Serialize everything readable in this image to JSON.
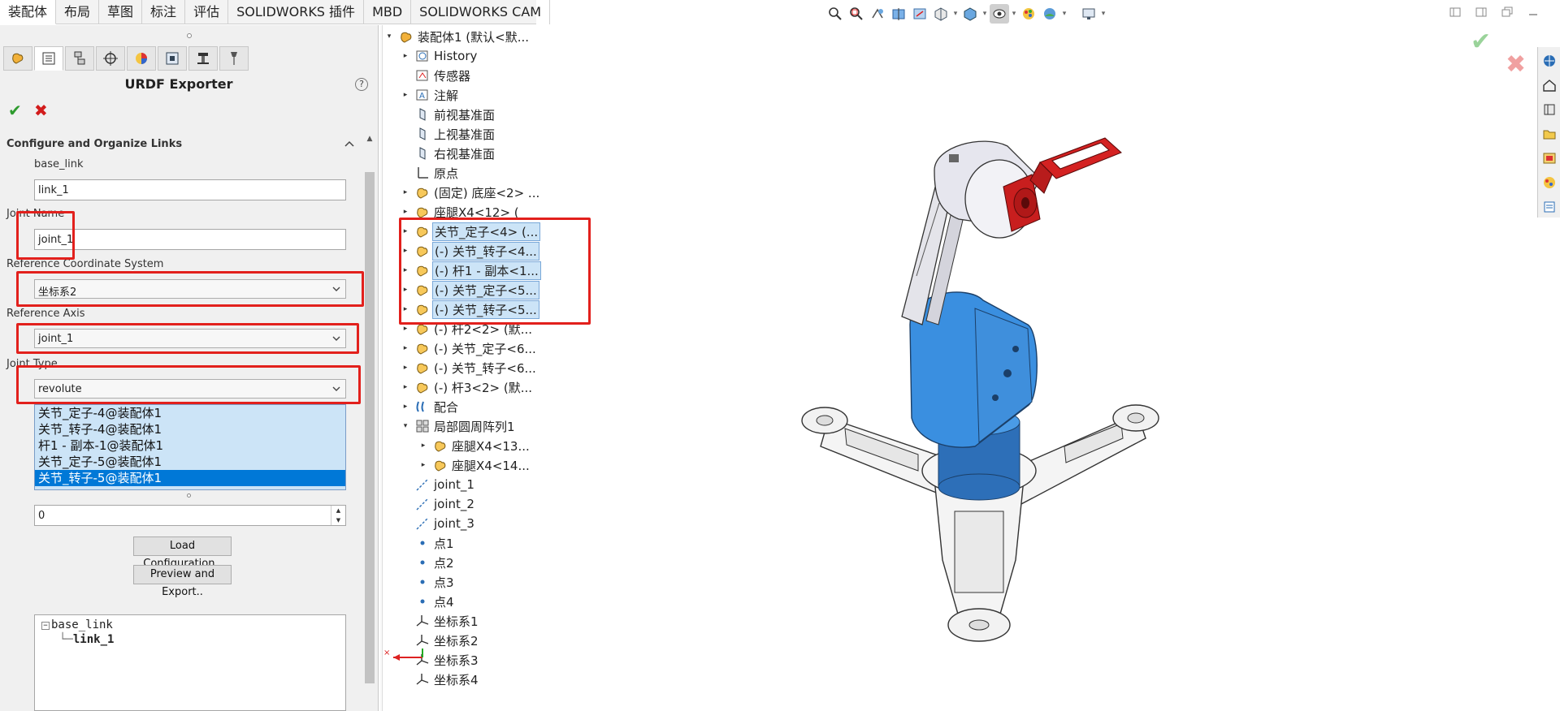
{
  "tabs": [
    "装配体",
    "布局",
    "草图",
    "标注",
    "评估",
    "SOLIDWORKS 插件",
    "MBD",
    "SOLIDWORKS CAM"
  ],
  "active_tab": "装配体",
  "hud_icons": [
    "zoom-to-fit-icon",
    "zoom-area-icon",
    "previous-view-icon",
    "section-view-icon",
    "dynamic-annotation-icon",
    "view-orientation-icon",
    "display-style-icon",
    "hide-show-icon",
    "edit-appearance-icon",
    "apply-scene-icon",
    "view-settings-icon"
  ],
  "property_manager": {
    "title": "URDF Exporter",
    "help": "?",
    "ok": "✔",
    "cancel": "✖",
    "group": "Configure and Organize Links",
    "link_label": "base_link",
    "link_name": "link_1",
    "joint_name_label": "Joint Name",
    "joint_name": "joint_1",
    "ref_coord_label": "Reference Coordinate System",
    "ref_coord": "坐标系2",
    "ref_axis_label": "Reference Axis",
    "ref_axis": "joint_1",
    "joint_type_label": "Joint Type",
    "joint_type": "revolute",
    "components": [
      "关节_定子-4@装配体1",
      "关节_转子-4@装配体1",
      "杆1 - 副本-1@装配体1",
      "关节_定子-5@装配体1",
      "关节_转子-5@装配体1"
    ],
    "selected_component_index": 4,
    "child_count": "0",
    "load_button": "Load Configuration..",
    "export_button": "Preview and Export..",
    "link_tree": {
      "root": "base_link",
      "child": "link_1"
    }
  },
  "feature_tree": [
    {
      "label": "装配体1 (默认<默...",
      "exp": "▾",
      "icon": "assembly-icon",
      "indent": 0
    },
    {
      "label": "History",
      "exp": "▸",
      "icon": "history-icon",
      "indent": 1
    },
    {
      "label": "传感器",
      "exp": "",
      "icon": "sensor-icon",
      "indent": 1
    },
    {
      "label": "注解",
      "exp": "▸",
      "icon": "annotation-icon",
      "indent": 1
    },
    {
      "label": "前视基准面",
      "exp": "",
      "icon": "plane-icon",
      "indent": 1
    },
    {
      "label": "上视基准面",
      "exp": "",
      "icon": "plane-icon",
      "indent": 1
    },
    {
      "label": "右视基准面",
      "exp": "",
      "icon": "plane-icon",
      "indent": 1
    },
    {
      "label": "原点",
      "exp": "",
      "icon": "origin-icon",
      "indent": 1
    },
    {
      "label": "(固定) 底座<2> ...",
      "exp": "▸",
      "icon": "part-icon",
      "indent": 1
    },
    {
      "label": "座腿X4<12> (",
      "exp": "▸",
      "icon": "part-icon",
      "indent": 1
    },
    {
      "label": "关节_定子<4> (...",
      "exp": "▸",
      "icon": "part-icon",
      "indent": 1,
      "hl": true
    },
    {
      "label": "(-) 关节_转子<4...",
      "exp": "▸",
      "icon": "part-icon",
      "indent": 1,
      "hl": true
    },
    {
      "label": "(-) 杆1 - 副本<1...",
      "exp": "▸",
      "icon": "part-icon",
      "indent": 1,
      "hl": true
    },
    {
      "label": "(-) 关节_定子<5...",
      "exp": "▸",
      "icon": "part-icon",
      "indent": 1,
      "hl": true
    },
    {
      "label": "(-) 关节_转子<5...",
      "exp": "▸",
      "icon": "part-icon",
      "indent": 1,
      "hl": true
    },
    {
      "label": "(-) 杆2<2> (默...",
      "exp": "▸",
      "icon": "part-icon",
      "indent": 1
    },
    {
      "label": "(-) 关节_定子<6...",
      "exp": "▸",
      "icon": "part-icon",
      "indent": 1
    },
    {
      "label": "(-) 关节_转子<6...",
      "exp": "▸",
      "icon": "part-icon",
      "indent": 1
    },
    {
      "label": "(-) 杆3<2> (默...",
      "exp": "▸",
      "icon": "part-icon",
      "indent": 1
    },
    {
      "label": "配合",
      "exp": "▸",
      "icon": "mate-icon",
      "indent": 1
    },
    {
      "label": "局部圆周阵列1",
      "exp": "▾",
      "icon": "pattern-icon",
      "indent": 1
    },
    {
      "label": "座腿X4<13...",
      "exp": "▸",
      "icon": "part-icon",
      "indent": 2
    },
    {
      "label": "座腿X4<14...",
      "exp": "▸",
      "icon": "part-icon",
      "indent": 2
    },
    {
      "label": "joint_1",
      "exp": "",
      "icon": "axis-icon",
      "indent": 1
    },
    {
      "label": "joint_2",
      "exp": "",
      "icon": "axis-icon",
      "indent": 1
    },
    {
      "label": "joint_3",
      "exp": "",
      "icon": "axis-icon",
      "indent": 1
    },
    {
      "label": "点1",
      "exp": "",
      "icon": "point-icon",
      "indent": 1
    },
    {
      "label": "点2",
      "exp": "",
      "icon": "point-icon",
      "indent": 1
    },
    {
      "label": "点3",
      "exp": "",
      "icon": "point-icon",
      "indent": 1
    },
    {
      "label": "点4",
      "exp": "",
      "icon": "point-icon",
      "indent": 1
    },
    {
      "label": "坐标系1",
      "exp": "",
      "icon": "coord-system-icon",
      "indent": 1
    },
    {
      "label": "坐标系2",
      "exp": "",
      "icon": "coord-system-icon",
      "indent": 1
    },
    {
      "label": "坐标系3",
      "exp": "",
      "icon": "coord-system-icon",
      "indent": 1
    },
    {
      "label": "坐标系4",
      "exp": "",
      "icon": "coord-system-icon",
      "indent": 1
    }
  ],
  "colors": {
    "accent": "#0078d7",
    "highlight": "#e2201c",
    "robot_blue": "#3a8fe0",
    "robot_red": "#d42222"
  }
}
